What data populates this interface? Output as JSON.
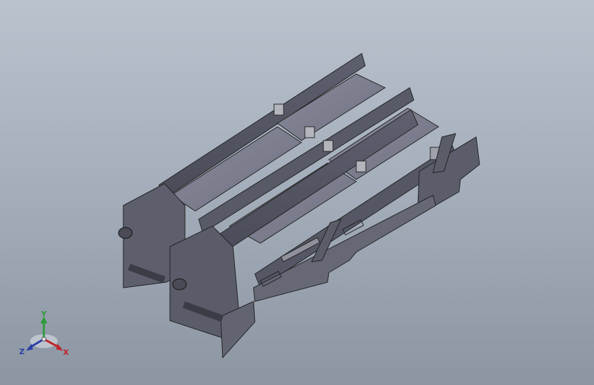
{
  "view": {
    "background_top": "#b9c2cd",
    "background_bottom": "#8c96a3",
    "model_color": "#6f7280",
    "belt_color": "#7d7f8f",
    "edge_color": "#2a2a2e"
  },
  "triad": {
    "y_label": "Y",
    "x_label": "X",
    "z_label": "Z",
    "y_color": "#2e9b3a",
    "x_color": "#c0262b",
    "z_color": "#2a3ea8"
  }
}
